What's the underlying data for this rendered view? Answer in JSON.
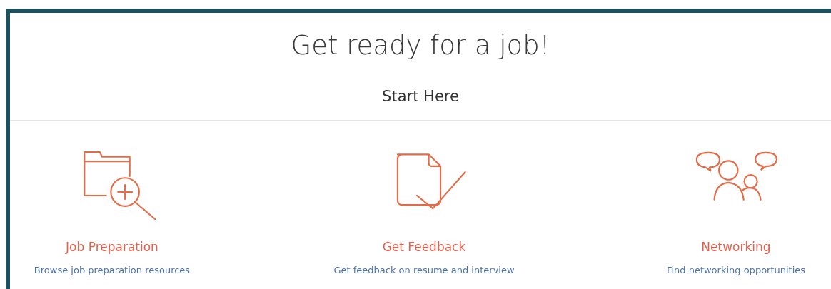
{
  "heading": "Get ready for a job!",
  "section_title": "Start Here",
  "options": [
    {
      "kind": "folder-search",
      "title": "Job Preparation",
      "description": "Browse job preparation resources"
    },
    {
      "kind": "document-check",
      "title": "Get Feedback",
      "description": "Get feedback on resume and interview"
    },
    {
      "kind": "people-chat",
      "title": "Networking",
      "description": "Find networking opportunities"
    }
  ]
}
